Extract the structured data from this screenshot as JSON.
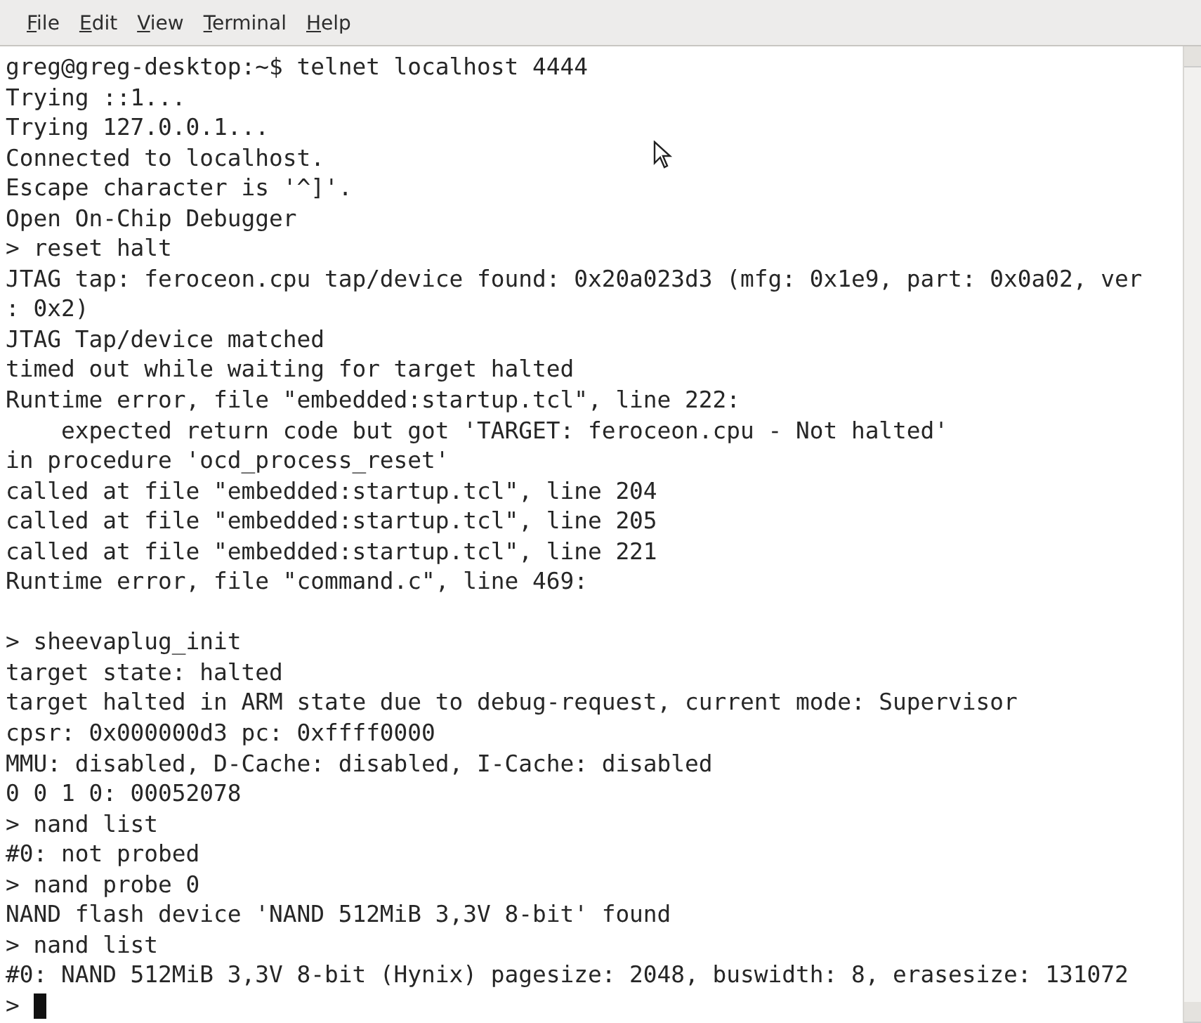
{
  "menu": [
    "File",
    "Edit",
    "View",
    "Terminal",
    "Help"
  ],
  "terminal": {
    "lines": [
      {
        "kind": "text",
        "text": "greg@greg-desktop:~$ telnet localhost 4444"
      },
      {
        "kind": "text",
        "text": "Trying ::1..."
      },
      {
        "kind": "text",
        "text": "Trying 127.0.0.1..."
      },
      {
        "kind": "text",
        "text": "Connected to localhost."
      },
      {
        "kind": "text",
        "text": "Escape character is '^]'."
      },
      {
        "kind": "text",
        "text": "Open On-Chip Debugger"
      },
      {
        "kind": "text",
        "text": "> reset halt"
      },
      {
        "kind": "text",
        "text": "JTAG tap: feroceon.cpu tap/device found: 0x20a023d3 (mfg: 0x1e9, part: 0x0a02, ver"
      },
      {
        "kind": "text",
        "text": ": 0x2)"
      },
      {
        "kind": "text",
        "text": "JTAG Tap/device matched"
      },
      {
        "kind": "text",
        "text": "timed out while waiting for target halted"
      },
      {
        "kind": "text",
        "text": "Runtime error, file \"embedded:startup.tcl\", line 222:"
      },
      {
        "kind": "text",
        "text": "    expected return code but got 'TARGET: feroceon.cpu - Not halted'"
      },
      {
        "kind": "text",
        "text": "in procedure 'ocd_process_reset'"
      },
      {
        "kind": "text",
        "text": "called at file \"embedded:startup.tcl\", line 204"
      },
      {
        "kind": "text",
        "text": "called at file \"embedded:startup.tcl\", line 205"
      },
      {
        "kind": "text",
        "text": "called at file \"embedded:startup.tcl\", line 221"
      },
      {
        "kind": "text",
        "text": "Runtime error, file \"command.c\", line 469:"
      },
      {
        "kind": "blank"
      },
      {
        "kind": "text",
        "text": "> sheevaplug_init"
      },
      {
        "kind": "text",
        "text": "target state: halted"
      },
      {
        "kind": "text",
        "text": "target halted in ARM state due to debug-request, current mode: Supervisor"
      },
      {
        "kind": "text",
        "text": "cpsr: 0x000000d3 pc: 0xffff0000"
      },
      {
        "kind": "text",
        "text": "MMU: disabled, D-Cache: disabled, I-Cache: disabled"
      },
      {
        "kind": "text",
        "text": "0 0 1 0: 00052078"
      },
      {
        "kind": "text",
        "text": "> nand list"
      },
      {
        "kind": "text",
        "text": "#0: not probed"
      },
      {
        "kind": "text",
        "text": "> nand probe 0"
      },
      {
        "kind": "text",
        "text": "NAND flash device 'NAND 512MiB 3,3V 8-bit' found"
      },
      {
        "kind": "text",
        "text": "> nand list"
      },
      {
        "kind": "text",
        "text": "#0: NAND 512MiB 3,3V 8-bit (Hynix) pagesize: 2048, buswidth: 8, erasesize: 131072"
      },
      {
        "kind": "prompt",
        "text": ">"
      }
    ]
  }
}
